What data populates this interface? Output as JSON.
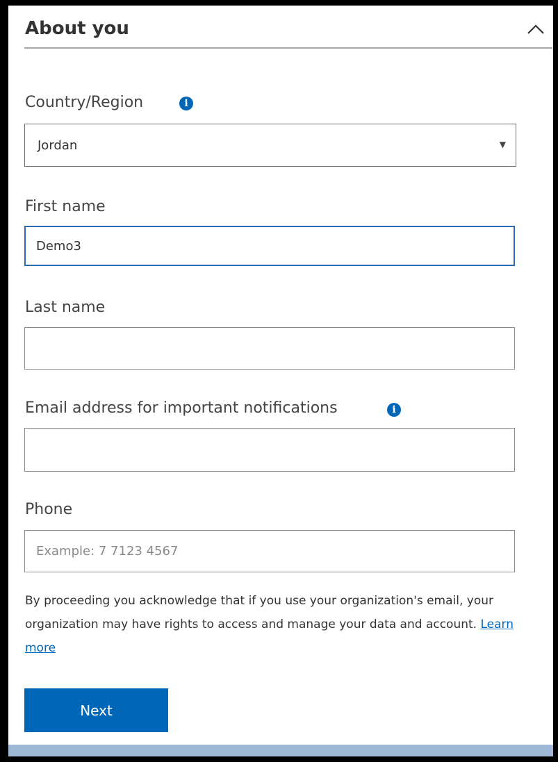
{
  "section": {
    "title": "About you",
    "collapse_icon": "chevron-up-icon"
  },
  "form": {
    "country": {
      "label": "Country/Region",
      "info_icon": "info-icon",
      "info_glyph": "i",
      "selected": "Jordan",
      "arrow_glyph": "▼"
    },
    "first_name": {
      "label": "First name",
      "value": "Demo3"
    },
    "last_name": {
      "label": "Last name",
      "value": ""
    },
    "email": {
      "label": "Email address for important notifications",
      "info_icon": "info-icon",
      "info_glyph": "i",
      "value": ""
    },
    "phone": {
      "label": "Phone",
      "value": "",
      "placeholder": "Example: 7 7123 4567"
    }
  },
  "disclaimer": {
    "text": "By proceeding you acknowledge that if you use your organization's email, your organization may have rights to access and manage your data and account. ",
    "link_text": "Learn more"
  },
  "actions": {
    "next_label": "Next"
  },
  "colors": {
    "accent": "#0067b8",
    "focus_border": "#2b6cb3"
  }
}
